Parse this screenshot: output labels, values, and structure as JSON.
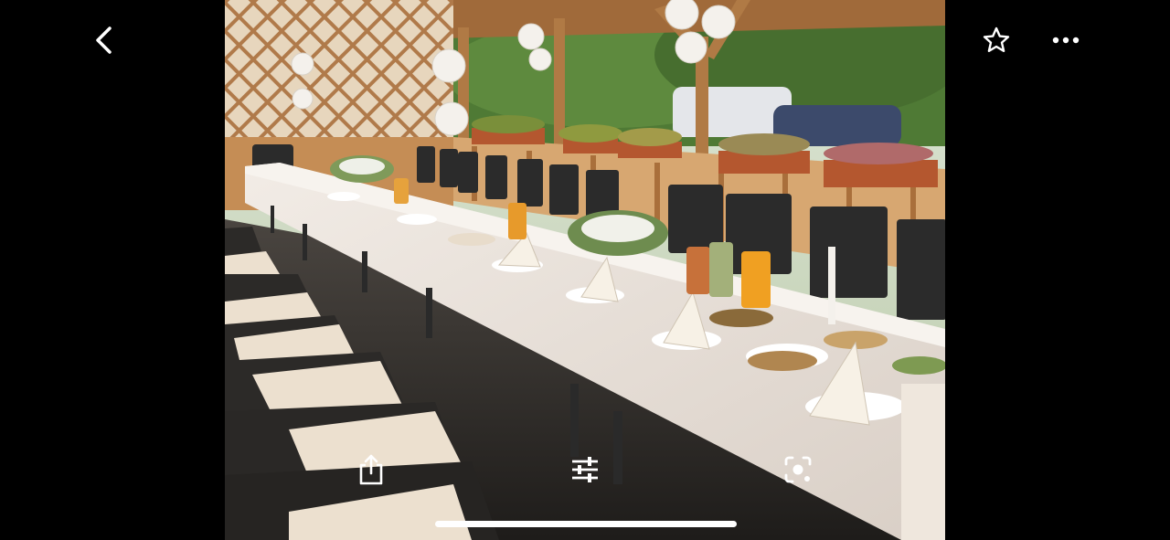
{
  "viewer": {
    "photo": {
      "description_icon": "image-photo"
    },
    "top_bar": {
      "back_icon": "chevron-left-icon",
      "favorite_icon": "star-outline-icon",
      "more_icon": "ellipsis-icon"
    },
    "bottom_bar": {
      "share_icon": "share-icon",
      "adjust_icon": "sliders-icon",
      "lens_icon": "visual-search-icon"
    },
    "colors": {
      "background": "#000000",
      "icon": "#ffffff"
    }
  }
}
